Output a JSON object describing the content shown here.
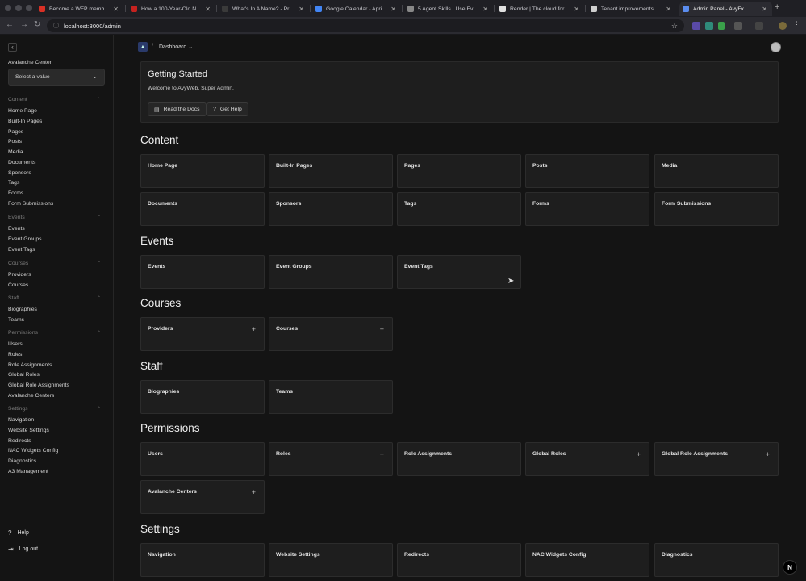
{
  "browser": {
    "tabs": [
      {
        "title": "Become a WFP member - V",
        "favicon_color": "#d93025"
      },
      {
        "title": "How a 100-Year-Old Name",
        "favicon_color": "#c5221f"
      },
      {
        "title": "What's In A Name? - Prote",
        "favicon_color": "#3a3a3a"
      },
      {
        "title": "Google Calendar - April 20",
        "favicon_color": "#4285f4"
      },
      {
        "title": "5 Agent Skills I Use Every",
        "favicon_color": "#888888"
      },
      {
        "title": "Render | The cloud for buil",
        "favicon_color": "#e0e0e0"
      },
      {
        "title": "Tenant improvements on a",
        "favicon_color": "#cfcfcf"
      },
      {
        "title": "Admin Panel - AvyFx",
        "favicon_color": "#5b8def"
      }
    ],
    "new_tab": "+",
    "url": "localhost:3000/admin"
  },
  "sidebar": {
    "back_icon": "‹",
    "org_label": "Avalanche Center",
    "org_select_placeholder": "Select a value",
    "groups": [
      {
        "title": "Content",
        "items": [
          "Home Page",
          "Built-In Pages",
          "Pages",
          "Posts",
          "Media",
          "Documents",
          "Sponsors",
          "Tags",
          "Forms",
          "Form Submissions"
        ]
      },
      {
        "title": "Events",
        "items": [
          "Events",
          "Event Groups",
          "Event Tags"
        ]
      },
      {
        "title": "Courses",
        "items": [
          "Providers",
          "Courses"
        ]
      },
      {
        "title": "Staff",
        "items": [
          "Biographies",
          "Teams"
        ]
      },
      {
        "title": "Permissions",
        "items": [
          "Users",
          "Roles",
          "Role Assignments",
          "Global Roles",
          "Global Role Assignments",
          "Avalanche Centers"
        ]
      },
      {
        "title": "Settings",
        "items": [
          "Navigation",
          "Website Settings",
          "Redirects",
          "NAC Widgets Config",
          "Diagnostics",
          "A3 Management"
        ]
      }
    ],
    "help": "Help",
    "logout": "Log out"
  },
  "header": {
    "breadcrumb": "Dashboard"
  },
  "getting_started": {
    "title": "Getting Started",
    "welcome": "Welcome to AvyWeb, Super Admin.",
    "docs_button": "Read the Docs",
    "help_button": "Get Help"
  },
  "sections": [
    {
      "title": "Content",
      "cards": [
        {
          "label": "Home Page",
          "plus": false
        },
        {
          "label": "Built-In Pages",
          "plus": false
        },
        {
          "label": "Pages",
          "plus": false
        },
        {
          "label": "Posts",
          "plus": false
        },
        {
          "label": "Media",
          "plus": false
        },
        {
          "label": "Documents",
          "plus": false
        },
        {
          "label": "Sponsors",
          "plus": false
        },
        {
          "label": "Tags",
          "plus": false
        },
        {
          "label": "Forms",
          "plus": false
        },
        {
          "label": "Form Submissions",
          "plus": false
        }
      ]
    },
    {
      "title": "Events",
      "cards": [
        {
          "label": "Events",
          "plus": false
        },
        {
          "label": "Event Groups",
          "plus": false
        },
        {
          "label": "Event Tags",
          "plus": false
        }
      ]
    },
    {
      "title": "Courses",
      "cards": [
        {
          "label": "Providers",
          "plus": true
        },
        {
          "label": "Courses",
          "plus": true
        }
      ]
    },
    {
      "title": "Staff",
      "cards": [
        {
          "label": "Biographies",
          "plus": false
        },
        {
          "label": "Teams",
          "plus": false
        }
      ]
    },
    {
      "title": "Permissions",
      "cards": [
        {
          "label": "Users",
          "plus": false
        },
        {
          "label": "Roles",
          "plus": true
        },
        {
          "label": "Role Assignments",
          "plus": false
        },
        {
          "label": "Global Roles",
          "plus": true
        },
        {
          "label": "Global Role Assignments",
          "plus": true
        },
        {
          "label": "Avalanche Centers",
          "plus": true
        }
      ]
    },
    {
      "title": "Settings",
      "cards": [
        {
          "label": "Navigation",
          "plus": false
        },
        {
          "label": "Website Settings",
          "plus": false
        },
        {
          "label": "Redirects",
          "plus": false
        },
        {
          "label": "NAC Widgets Config",
          "plus": false
        },
        {
          "label": "Diagnostics",
          "plus": false
        }
      ]
    }
  ],
  "nextjs_badge": "N"
}
